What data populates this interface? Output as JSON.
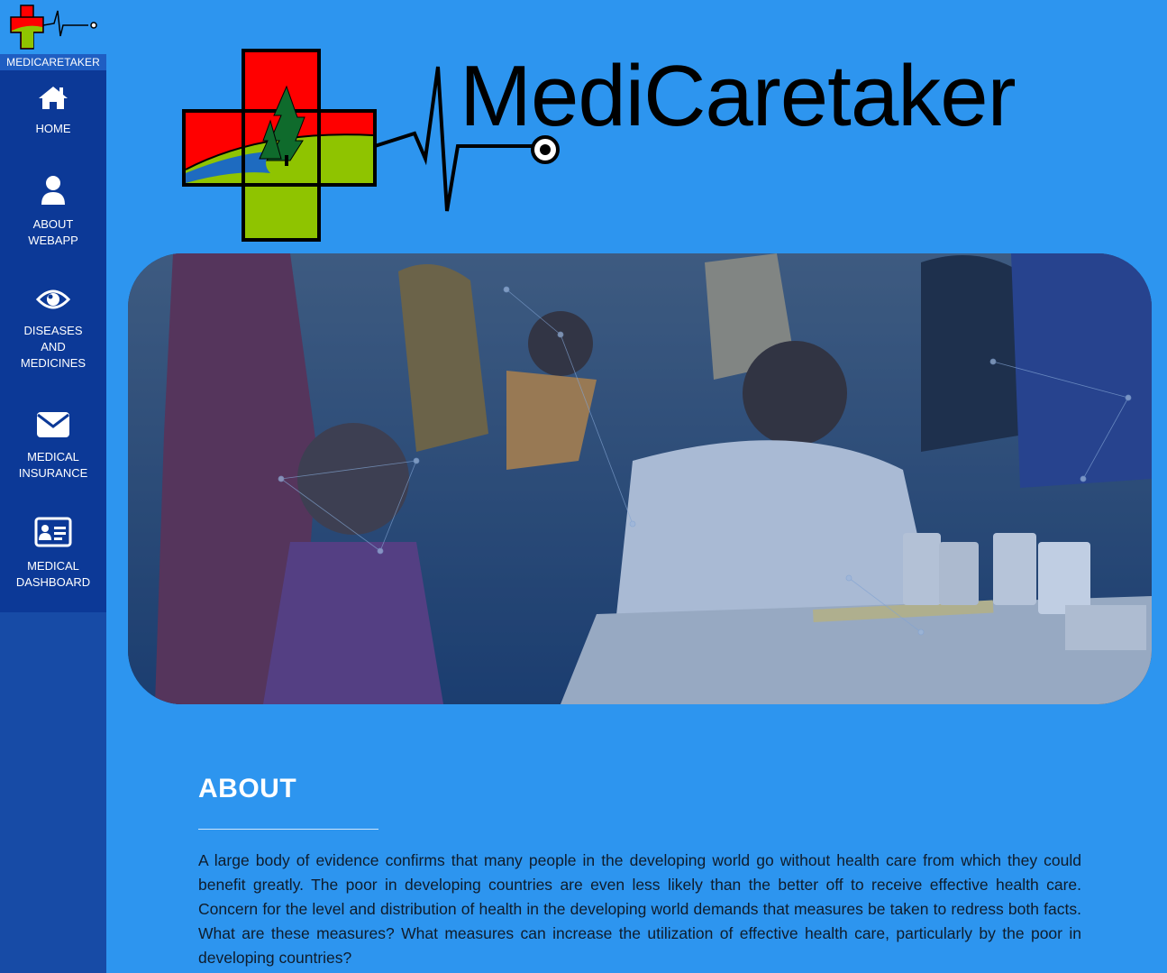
{
  "sidebar": {
    "brand": "MEDICARETAKER",
    "items": [
      {
        "label": "HOME",
        "icon": "home-icon"
      },
      {
        "label": "ABOUT\nWEBAPP",
        "icon": "user-icon"
      },
      {
        "label": "DISEASES\nAND\nMEDICINES",
        "icon": "eye-icon"
      },
      {
        "label": "MEDICAL\nINSURANCE",
        "icon": "envelope-icon"
      },
      {
        "label": "MEDICAL\nDASHBOARD",
        "icon": "id-card-icon"
      }
    ]
  },
  "header": {
    "brand_name": "MediCaretaker"
  },
  "about": {
    "heading": "ABOUT",
    "body": "A large body of evidence confirms that many people in the developing world go without health care from which they could benefit greatly. The poor in developing countries are even less likely than the better off to receive effective health care. Concern for the level and distribution of health in the developing world demands that measures be taken to redress both facts. What are these measures? What measures can increase the utilization of effective health care, particularly by the poor in developing countries?"
  },
  "colors": {
    "page_bg": "#2d95ef",
    "sidebar_bg": "#0c3997",
    "cross_red": "#ff0000",
    "cross_green": "#8fc400"
  }
}
